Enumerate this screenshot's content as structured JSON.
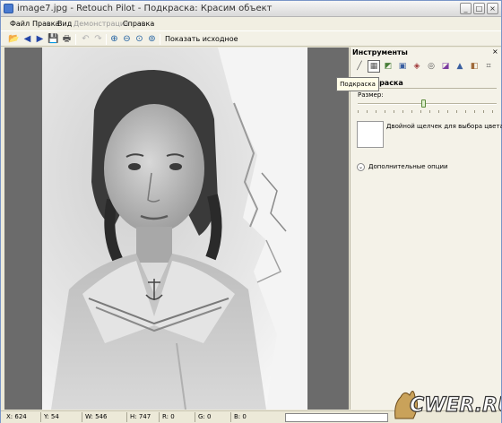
{
  "window": {
    "title": "image7.jpg - Retouch Pilot - Подкраска: Красим объект",
    "buttons": {
      "minimize": "_",
      "maximize": "□",
      "close": "×"
    }
  },
  "menu": {
    "items": [
      {
        "label": "Файл",
        "enabled": true
      },
      {
        "label": "Правка",
        "enabled": true
      },
      {
        "label": "Вид",
        "enabled": true
      },
      {
        "label": "Демонстрация",
        "enabled": false
      },
      {
        "label": "Справка",
        "enabled": true
      }
    ]
  },
  "toolbar": {
    "buttons": [
      {
        "name": "open-icon",
        "glyph": "📂",
        "enabled": true
      },
      {
        "name": "back-icon",
        "glyph": "◀",
        "enabled": true
      },
      {
        "name": "forward-icon",
        "glyph": "▶",
        "enabled": true
      },
      {
        "name": "save-icon",
        "glyph": "💾",
        "enabled": true
      },
      {
        "name": "print-icon",
        "glyph": "🖶",
        "enabled": true
      },
      {
        "name": "undo-icon",
        "glyph": "↶",
        "enabled": false
      },
      {
        "name": "redo-icon",
        "glyph": "↷",
        "enabled": false
      },
      {
        "name": "zoom-in-icon",
        "glyph": "⊕",
        "enabled": true
      },
      {
        "name": "zoom-out-icon",
        "glyph": "⊖",
        "enabled": true
      },
      {
        "name": "zoom-fit-icon",
        "glyph": "⊙",
        "enabled": true
      },
      {
        "name": "zoom-actual-icon",
        "glyph": "⊚",
        "enabled": true
      }
    ],
    "show_original": "Показать исходное"
  },
  "panel": {
    "title": "Инструменты",
    "close": "×",
    "tools": [
      {
        "name": "brush-tool-icon",
        "glyph": "╱",
        "active": false
      },
      {
        "name": "paint-tool-icon",
        "glyph": "▦",
        "active": true
      },
      {
        "name": "clone-tool-icon",
        "glyph": "◩",
        "active": false
      },
      {
        "name": "patch-tool-icon",
        "glyph": "▣",
        "active": false
      },
      {
        "name": "bucket-tool-icon",
        "glyph": "◈",
        "active": false
      },
      {
        "name": "target-tool-icon",
        "glyph": "◎",
        "active": false
      },
      {
        "name": "adjust-tool-icon",
        "glyph": "◪",
        "active": false
      },
      {
        "name": "levels-tool-icon",
        "glyph": "▲",
        "active": false
      },
      {
        "name": "colorize-tool-icon",
        "glyph": "◧",
        "active": false
      },
      {
        "name": "crop-tool-icon",
        "glyph": "⌗",
        "active": false
      }
    ],
    "tooltip": "Подкраска",
    "section_title": "Подкраска",
    "size_label": "Размер:",
    "size_value_fraction": 0.47,
    "color_hint": "Двойной щелчек для выбора цвета",
    "more_options": "Дополнительные опции",
    "colors": {
      "swatch": "#ffffff",
      "panel_bg": "#f4f2e8"
    }
  },
  "status": {
    "x": "X: 624",
    "y": "Y: 54",
    "w": "W: 546",
    "h": "H: 747",
    "r": "R: 0",
    "g": "G: 0",
    "b": "B: 0"
  },
  "watermark": "CWER.RU"
}
